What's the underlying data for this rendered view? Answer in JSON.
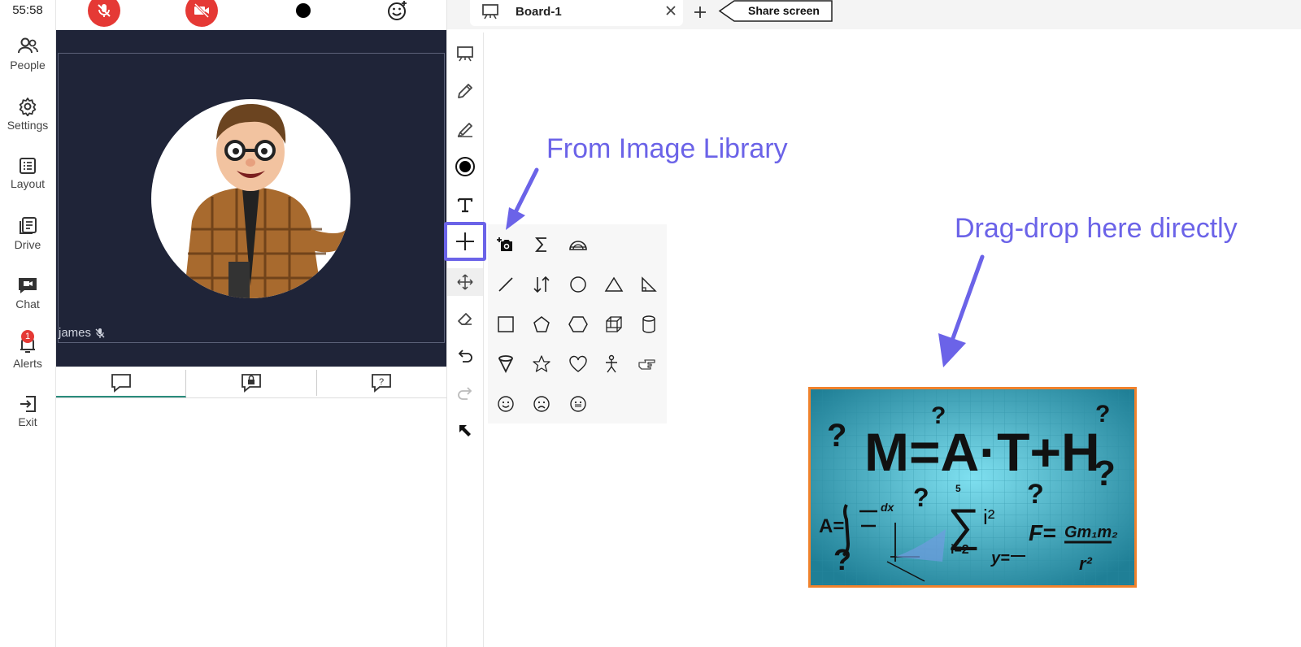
{
  "timer": "55:58",
  "nav": [
    {
      "label": "People",
      "icon": "people-icon"
    },
    {
      "label": "Settings",
      "icon": "gear-icon"
    },
    {
      "label": "Layout",
      "icon": "layout-icon"
    },
    {
      "label": "Drive",
      "icon": "drive-icon"
    },
    {
      "label": "Chat",
      "icon": "chat-icon"
    },
    {
      "label": "Alerts",
      "icon": "bell-icon",
      "badge": "1"
    },
    {
      "label": "Exit",
      "icon": "exit-icon"
    }
  ],
  "participant": {
    "name": "james"
  },
  "board": {
    "tab_label": "Board-1",
    "share_label": "Share screen"
  },
  "annotations": {
    "image_library": "From Image Library",
    "drag_drop": "Drag-drop here directly"
  },
  "math_image": {
    "title": "M=A·T+H",
    "formula_area": "A=",
    "formula_sum": "∑",
    "formula_sum_top": "5",
    "formula_sum_bottom": "i=2",
    "formula_i2": "i²",
    "formula_force": "F=",
    "formula_gm": "Gm₁m₂",
    "formula_r2": "r²",
    "formula_y": "y=",
    "formula_dx": "dx",
    "question_mark": "?"
  },
  "colors": {
    "accent": "#6b63e8",
    "danger": "#e53935",
    "video_bg": "#1f2438",
    "image_border": "#f0822c"
  }
}
